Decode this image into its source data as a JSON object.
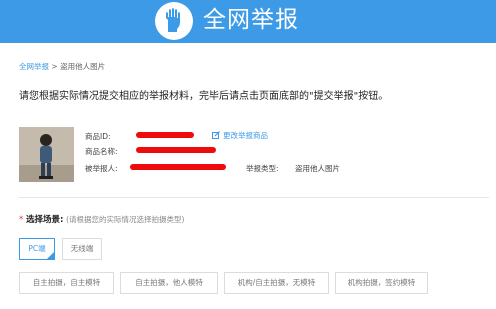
{
  "header": {
    "title": "全网举报",
    "brand_color": "#3c9ae6"
  },
  "breadcrumb": {
    "home": "全网举报",
    "separator": ">",
    "current": "盗用他人图片"
  },
  "instruction": "请您根据实际情况提交相应的举报材料，完毕后请点击页面底部的\"提交举报\"按钮。",
  "product": {
    "id_label": "商品ID:",
    "name_label": "商品名称:",
    "reported_label": "被举报人:",
    "edit_label": "更改举报商品",
    "type_label": "举报类型:",
    "type_value": "盗用他人图片",
    "redaction_color": "#ee0b0b"
  },
  "scene": {
    "star": "*",
    "label": "选择场景:",
    "hint": "(请根据您的实际情况选择拍摄类型)",
    "tabs": [
      "PC端",
      "无线端"
    ],
    "selected_tab": "PC端",
    "options": [
      "自主拍摄，自主模特",
      "自主拍摄，他人模特",
      "机构/自主拍摄，无模特",
      "机构拍摄，签约模特"
    ]
  }
}
